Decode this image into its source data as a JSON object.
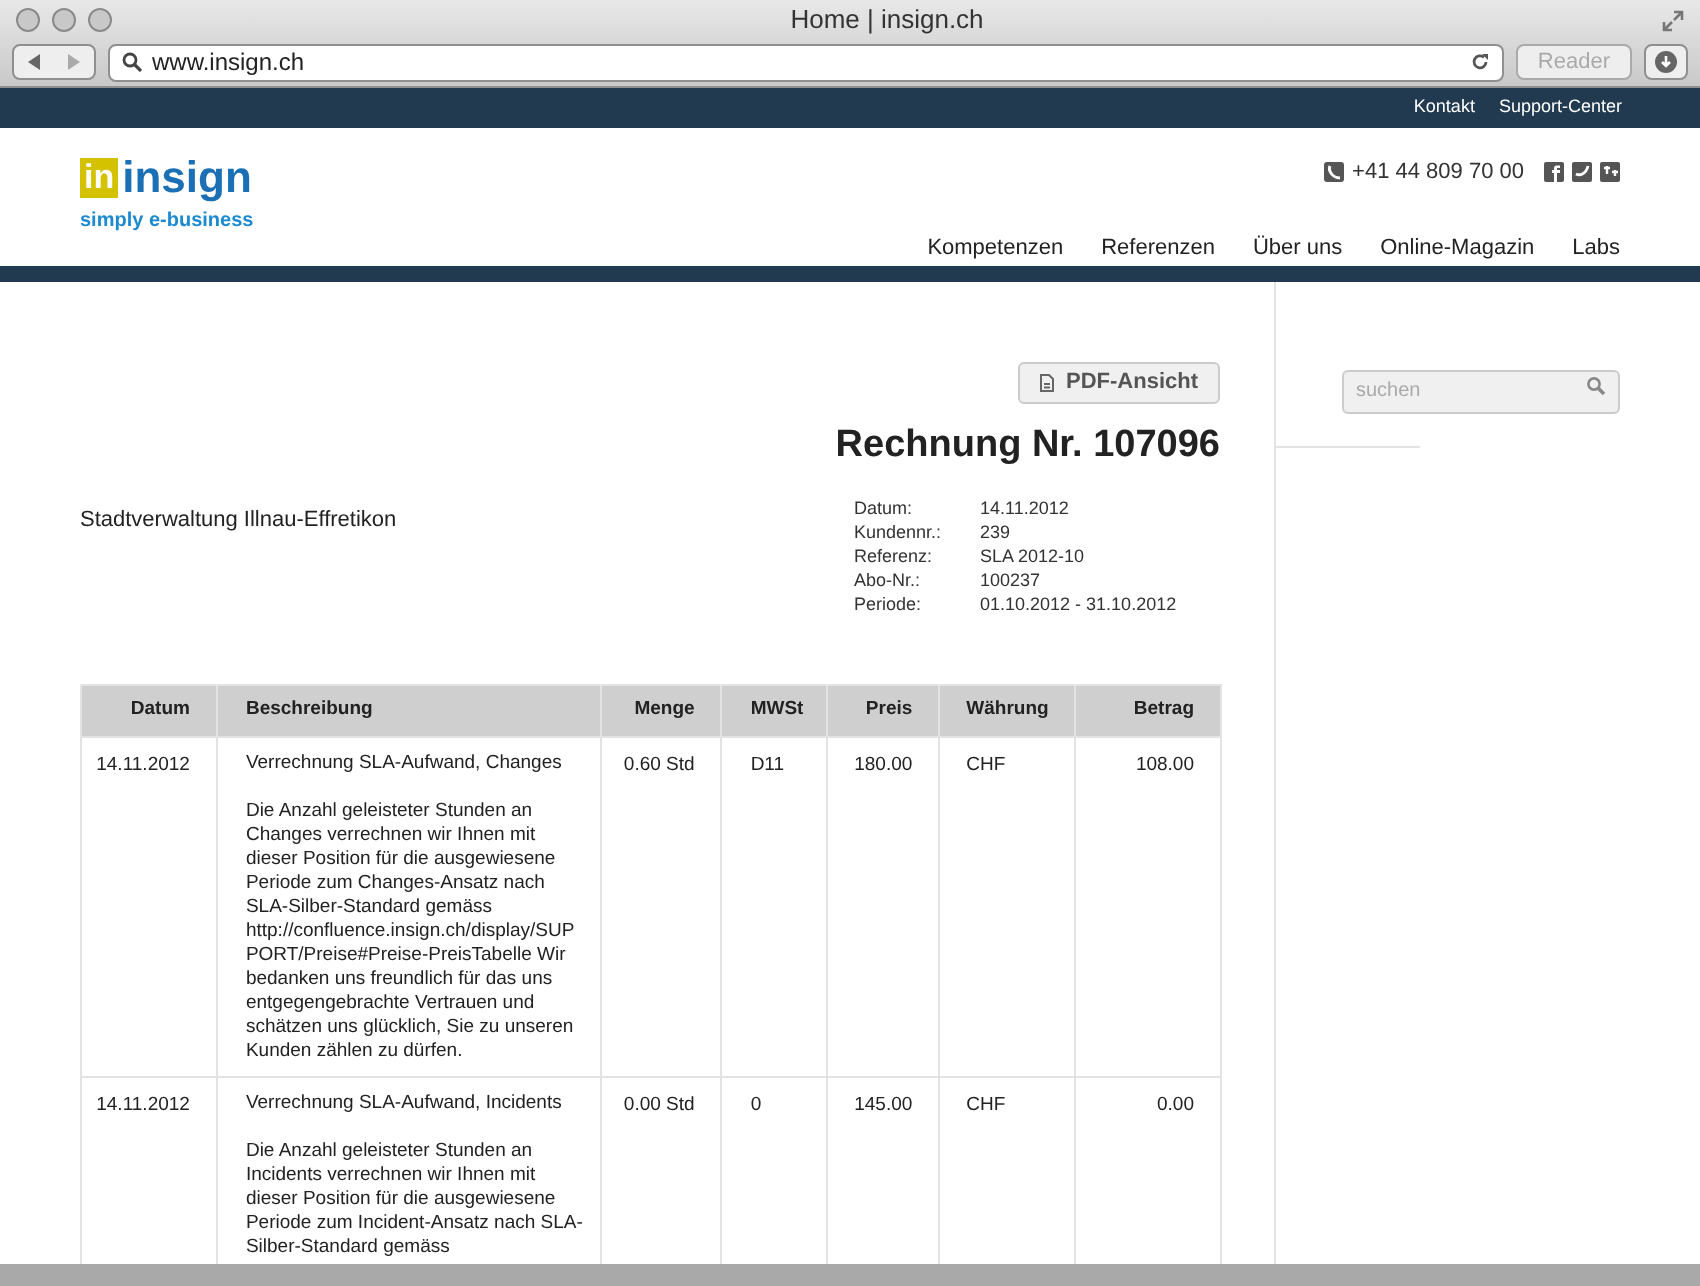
{
  "window": {
    "title": "Home | insign.ch"
  },
  "toolbar": {
    "url": "www.insign.ch",
    "reader_button": "Reader",
    "reader_disabled": true
  },
  "top_links": [
    "Kontakt",
    "Support-Center"
  ],
  "logo": {
    "mark": "in",
    "name": "insign",
    "tagline": "simply e-business"
  },
  "phone": "+41 44 809 70 00",
  "nav": [
    {
      "label": "Kompetenzen"
    },
    {
      "label": "Referenzen"
    },
    {
      "label": "Über uns"
    },
    {
      "label": "Online-Magazin"
    },
    {
      "label": "Labs"
    }
  ],
  "pdf_button": "PDF-Ansicht",
  "invoice_title": "Rechnung Nr. 107096",
  "recipient": "Stadtverwaltung Illnau-Effretikon",
  "details": [
    {
      "label": "Datum:",
      "value": "14.11.2012"
    },
    {
      "label": "Kundennr.:",
      "value": "239"
    },
    {
      "label": "Referenz:",
      "value": "SLA 2012-10"
    },
    {
      "label": "Abo-Nr.:",
      "value": "100237"
    },
    {
      "label": "Periode:",
      "value": "01.10.2012 - 31.10.2012"
    }
  ],
  "table": {
    "columns": [
      "Datum",
      "Beschreibung",
      "Menge",
      "MWSt",
      "Preis",
      "Währung",
      "Betrag"
    ],
    "rows": [
      {
        "date": "14.11.2012",
        "title": "Verrechnung SLA-Aufwand, Changes",
        "text": "Die Anzahl geleisteter Stunden an Changes verrechnen wir Ihnen mit dieser Position für die ausgewiesene Periode zum Changes-Ansatz nach SLA-Silber-Standard gemäss http://confluence.insign.ch/display/SUPPORT/Preise#Preise-PreisTabelle Wir bedanken uns freundlich für das uns entgegengebrachte Vertrauen und schätzen uns glücklich, Sie zu unseren Kunden zählen zu dürfen.",
        "quantity": "0.60 Std",
        "vat": "D11",
        "price": "180.00",
        "currency": "CHF",
        "amount": "108.00"
      },
      {
        "date": "14.11.2012",
        "title": "Verrechnung SLA-Aufwand, Incidents",
        "text": "Die Anzahl geleisteter Stunden an Incidents verrechnen wir Ihnen mit dieser Position für die ausgewiesene Periode zum Incident-Ansatz nach SLA-Silber-Standard gemäss",
        "quantity": "0.00 Std",
        "vat": "0",
        "price": "145.00",
        "currency": "CHF",
        "amount": "0.00"
      }
    ]
  },
  "search": {
    "placeholder": "suchen"
  }
}
